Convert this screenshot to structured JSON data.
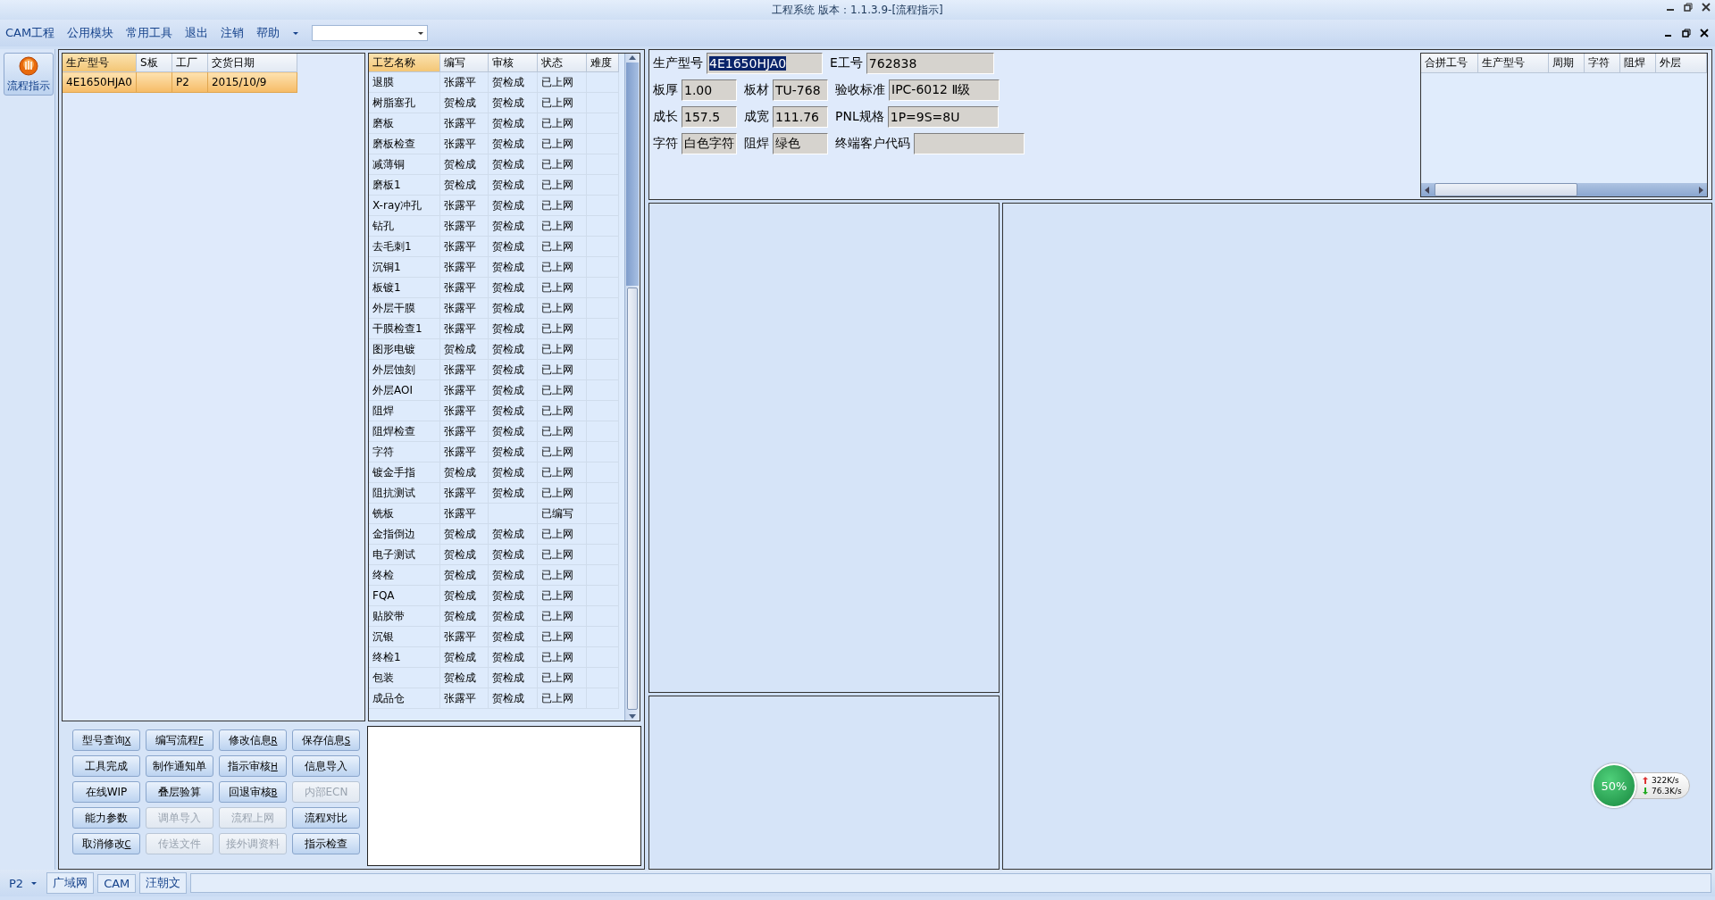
{
  "window": {
    "title": "工程系统 版本：1.1.3.9-[流程指示]"
  },
  "menu": {
    "items": [
      "CAM工程",
      "公用模块",
      "常用工具",
      "退出",
      "注销",
      "帮助"
    ]
  },
  "nav": [
    {
      "label": "流程指示",
      "selected": true
    }
  ],
  "orders": {
    "columns": [
      "生产型号",
      "S板",
      "工厂",
      "交货日期"
    ],
    "rows": [
      {
        "model": "4E1650HJA0",
        "factory": "P2",
        "delivery": "2015/10/9",
        "selected": true
      }
    ]
  },
  "processes": {
    "columns": [
      "工艺名称",
      "编写",
      "审核",
      "状态",
      "难度"
    ],
    "rows": [
      {
        "name": "退膜",
        "writer": "张露平",
        "reviewer": "贺检成",
        "status": "已上网"
      },
      {
        "name": "树脂塞孔",
        "writer": "贺检成",
        "reviewer": "贺检成",
        "status": "已上网"
      },
      {
        "name": "磨板",
        "writer": "张露平",
        "reviewer": "贺检成",
        "status": "已上网"
      },
      {
        "name": "磨板检查",
        "writer": "张露平",
        "reviewer": "贺检成",
        "status": "已上网"
      },
      {
        "name": "减薄铜",
        "writer": "贺检成",
        "reviewer": "贺检成",
        "status": "已上网"
      },
      {
        "name": "磨板1",
        "writer": "贺检成",
        "reviewer": "贺检成",
        "status": "已上网"
      },
      {
        "name": "X-ray冲孔",
        "writer": "张露平",
        "reviewer": "贺检成",
        "status": "已上网"
      },
      {
        "name": "钻孔",
        "writer": "张露平",
        "reviewer": "贺检成",
        "status": "已上网"
      },
      {
        "name": "去毛刺1",
        "writer": "张露平",
        "reviewer": "贺检成",
        "status": "已上网"
      },
      {
        "name": "沉铜1",
        "writer": "张露平",
        "reviewer": "贺检成",
        "status": "已上网"
      },
      {
        "name": "板镀1",
        "writer": "张露平",
        "reviewer": "贺检成",
        "status": "已上网"
      },
      {
        "name": "外层干膜",
        "writer": "张露平",
        "reviewer": "贺检成",
        "status": "已上网"
      },
      {
        "name": "干膜检查1",
        "writer": "张露平",
        "reviewer": "贺检成",
        "status": "已上网"
      },
      {
        "name": "图形电镀",
        "writer": "贺检成",
        "reviewer": "贺检成",
        "status": "已上网"
      },
      {
        "name": "外层蚀刻",
        "writer": "张露平",
        "reviewer": "贺检成",
        "status": "已上网"
      },
      {
        "name": "外层AOI",
        "writer": "张露平",
        "reviewer": "贺检成",
        "status": "已上网"
      },
      {
        "name": "阻焊",
        "writer": "张露平",
        "reviewer": "贺检成",
        "status": "已上网"
      },
      {
        "name": "阻焊检查",
        "writer": "张露平",
        "reviewer": "贺检成",
        "status": "已上网"
      },
      {
        "name": "字符",
        "writer": "张露平",
        "reviewer": "贺检成",
        "status": "已上网"
      },
      {
        "name": "镀金手指",
        "writer": "贺检成",
        "reviewer": "贺检成",
        "status": "已上网"
      },
      {
        "name": "阻抗测试",
        "writer": "张露平",
        "reviewer": "贺检成",
        "status": "已上网"
      },
      {
        "name": "铣板",
        "writer": "张露平",
        "status": "已编写"
      },
      {
        "name": "金指倒边",
        "writer": "贺检成",
        "reviewer": "贺检成",
        "status": "已上网"
      },
      {
        "name": "电子测试",
        "writer": "贺检成",
        "reviewer": "贺检成",
        "status": "已上网"
      },
      {
        "name": "终检",
        "writer": "贺检成",
        "reviewer": "贺检成",
        "status": "已上网"
      },
      {
        "name": "FQA",
        "writer": "贺检成",
        "reviewer": "贺检成",
        "status": "已上网"
      },
      {
        "name": "贴胶带",
        "writer": "贺检成",
        "reviewer": "贺检成",
        "status": "已上网"
      },
      {
        "name": "沉银",
        "writer": "张露平",
        "reviewer": "贺检成",
        "status": "已上网"
      },
      {
        "name": "终检1",
        "writer": "贺检成",
        "reviewer": "贺检成",
        "status": "已上网"
      },
      {
        "name": "包装",
        "writer": "贺检成",
        "reviewer": "贺检成",
        "status": "已上网"
      },
      {
        "name": "成品仓",
        "writer": "张露平",
        "reviewer": "贺检成",
        "status": "已上网"
      }
    ]
  },
  "buttons": [
    {
      "label": "型号查询",
      "shortcut": "X",
      "disabled": false
    },
    {
      "label": "编写流程",
      "shortcut": "F",
      "disabled": false
    },
    {
      "label": "修改信息",
      "shortcut": "R",
      "disabled": false
    },
    {
      "label": "保存信息",
      "shortcut": "S",
      "disabled": false
    },
    {
      "label": "工具完成",
      "disabled": false
    },
    {
      "label": "制作通知单",
      "disabled": false
    },
    {
      "label": "指示审核",
      "shortcut": "H",
      "disabled": false
    },
    {
      "label": "信息导入",
      "disabled": false
    },
    {
      "label": "在线WIP",
      "disabled": false
    },
    {
      "label": "叠层验算",
      "disabled": false
    },
    {
      "label": "回退审核",
      "shortcut": "B",
      "disabled": false
    },
    {
      "label": "内部ECN",
      "disabled": true
    },
    {
      "label": "能力参数",
      "disabled": false
    },
    {
      "label": "调单导入",
      "disabled": true
    },
    {
      "label": "流程上网",
      "disabled": true
    },
    {
      "label": "流程对比",
      "disabled": false
    },
    {
      "label": "取消修改",
      "shortcut": "C",
      "disabled": false
    },
    {
      "label": "传送文件",
      "disabled": true
    },
    {
      "label": "接外调资料",
      "disabled": true
    },
    {
      "label": "指示检查",
      "disabled": false
    }
  ],
  "form": {
    "fields": [
      {
        "label": "生产型号",
        "value": "4E1650HJA0",
        "selected": true
      },
      {
        "label": "E工号",
        "value": "762838",
        "selected": false
      },
      {
        "label": "板厚",
        "value": "1.00",
        "selected": false
      },
      {
        "label": "板材",
        "value": "TU-768",
        "selected": false
      },
      {
        "label": "验收标准",
        "value": "IPC-6012 Ⅱ级",
        "selected": false
      },
      {
        "label": "成长",
        "value": "157.5",
        "selected": false
      },
      {
        "label": "成宽",
        "value": "111.76",
        "selected": false
      },
      {
        "label": "PNL规格",
        "value": "1P=9S=8U",
        "selected": false
      },
      {
        "label": "字符",
        "value": "白色字符",
        "selected": false
      },
      {
        "label": "阻焊",
        "value": "绿色",
        "selected": false
      },
      {
        "label": "终端客户代码",
        "selected": false
      }
    ]
  },
  "merge_table": {
    "columns": [
      "合拼工号",
      "生产型号",
      "周期",
      "字符",
      "阻焊",
      "外层"
    ]
  },
  "speed_widget": {
    "percent": "50%",
    "upload": "322K/s",
    "download": "76.3K/s"
  },
  "status_bar": {
    "items": [
      "P2",
      "广域网",
      "CAM",
      "汪朝文"
    ]
  }
}
